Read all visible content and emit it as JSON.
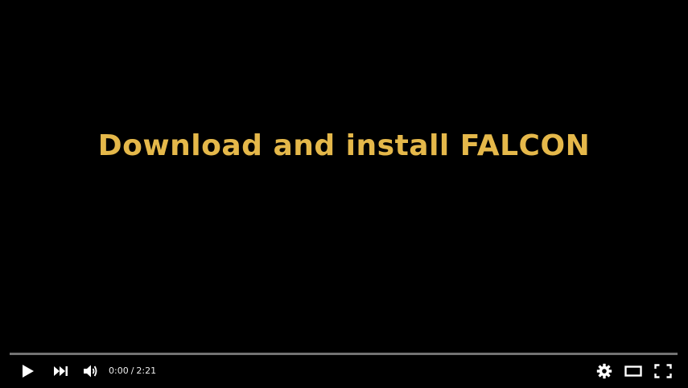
{
  "video": {
    "title_text": "Download and install FALCON",
    "title_color": "#e5b84a",
    "background_color": "#000000"
  },
  "progress": {
    "played_fraction": 0.0
  },
  "controls": {
    "play_icon": "play-icon",
    "next_icon": "next-icon",
    "volume_icon": "volume-icon",
    "settings_icon": "gear-icon",
    "theater_icon": "theater-mode-icon",
    "fullscreen_icon": "fullscreen-icon",
    "current_time": "0:00",
    "separator": "/",
    "duration": "2:21"
  }
}
